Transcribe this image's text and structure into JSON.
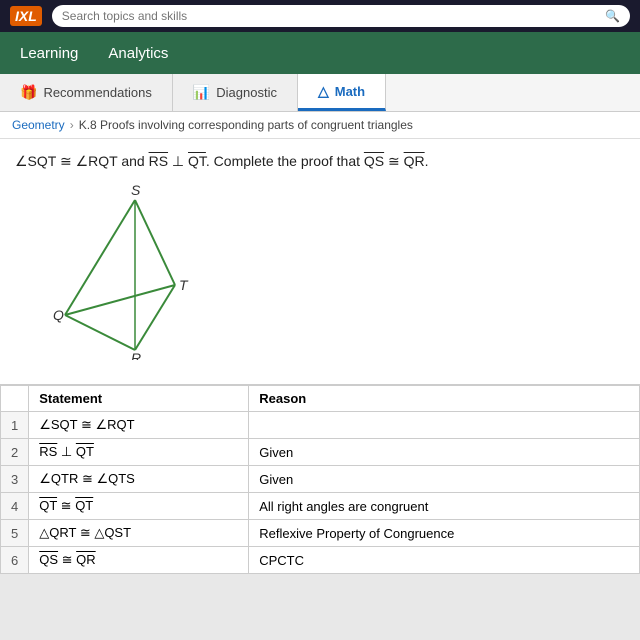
{
  "topbar": {
    "logo": "IXL",
    "search_placeholder": "Search topics and skills"
  },
  "navbar": {
    "items": [
      {
        "label": "Learning",
        "active": false
      },
      {
        "label": "Analytics",
        "active": false
      }
    ]
  },
  "tabs": [
    {
      "label": "Recommendations",
      "icon": "🎁",
      "active": false
    },
    {
      "label": "Diagnostic",
      "icon": "📊",
      "active": false
    },
    {
      "label": "Math",
      "icon": "△",
      "active": true
    }
  ],
  "breadcrumb": {
    "subject": "Geometry",
    "topic": "K.8 Proofs involving corresponding parts of congruent triangles"
  },
  "problem": {
    "text_parts": {
      "angle_sqt": "∠SQT",
      "cong": "≅",
      "angle_rqt": "∠RQT",
      "and": "and",
      "rs_bar": "RS",
      "perp": "⊥",
      "qt_bar": "QT",
      "period": ".",
      "complete": "Complete the proof that",
      "qs_bar": "QS",
      "cong2": "≅",
      "qr_bar": "QR",
      "period2": "."
    }
  },
  "proof_table": {
    "headers": [
      "",
      "Statement",
      "Reason"
    ],
    "rows": [
      {
        "num": "1",
        "statement": "∠SQT ≅ ∠RQT",
        "reason": ""
      },
      {
        "num": "2",
        "statement": "RS ⊥ QT",
        "reason": "Given"
      },
      {
        "num": "3",
        "statement": "∠QTR ≅ ∠QTS",
        "reason": "Given"
      },
      {
        "num": "4",
        "statement": "QT ≅ QT",
        "reason": "All right angles are congruent"
      },
      {
        "num": "5",
        "statement": "△QRT ≅ △QST",
        "reason": "Reflexive Property of Congruence"
      },
      {
        "num": "6",
        "statement": "QS ≅ QR",
        "reason": "CPCTC"
      }
    ]
  }
}
